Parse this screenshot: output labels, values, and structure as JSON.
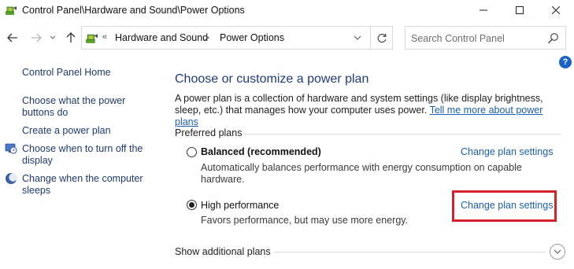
{
  "window": {
    "title": "Control Panel\\Hardware and Sound\\Power Options"
  },
  "address": {
    "overflow_glyph": "«",
    "crumbs": [
      "Hardware and Sound",
      "Power Options"
    ],
    "separator": ">"
  },
  "search": {
    "placeholder": "Search Control Panel",
    "value": ""
  },
  "help": {
    "glyph": "?"
  },
  "sidebar": {
    "items": [
      {
        "label": "Control Panel Home",
        "icon": ""
      },
      {
        "label": "Choose what the power buttons do",
        "icon": ""
      },
      {
        "label": "Create a power plan",
        "icon": ""
      },
      {
        "label": "Choose when to turn off the display",
        "icon": "display-clock-icon"
      },
      {
        "label": "Change when the computer sleeps",
        "icon": "moon-sleep-icon"
      }
    ]
  },
  "main": {
    "heading": "Choose or customize a power plan",
    "intro_text": "A power plan is a collection of hardware and system settings (like display brightness, sleep, etc.) that manages how your computer uses power. ",
    "intro_link": "Tell me more about power plans",
    "section_label": "Preferred plans",
    "plans": [
      {
        "name": "Balanced (recommended)",
        "description": "Automatically balances performance with energy consumption on capable hardware.",
        "selected": false,
        "change_label": "Change plan settings"
      },
      {
        "name": "High performance",
        "description": "Favors performance, but may use more energy.",
        "selected": true,
        "change_label": "Change plan settings"
      }
    ],
    "show_additional": "Show additional plans"
  },
  "colors": {
    "heading": "#1e3a7e",
    "link": "#1a5fb4",
    "highlight": "#d6202b",
    "help": "#1a63c6"
  }
}
